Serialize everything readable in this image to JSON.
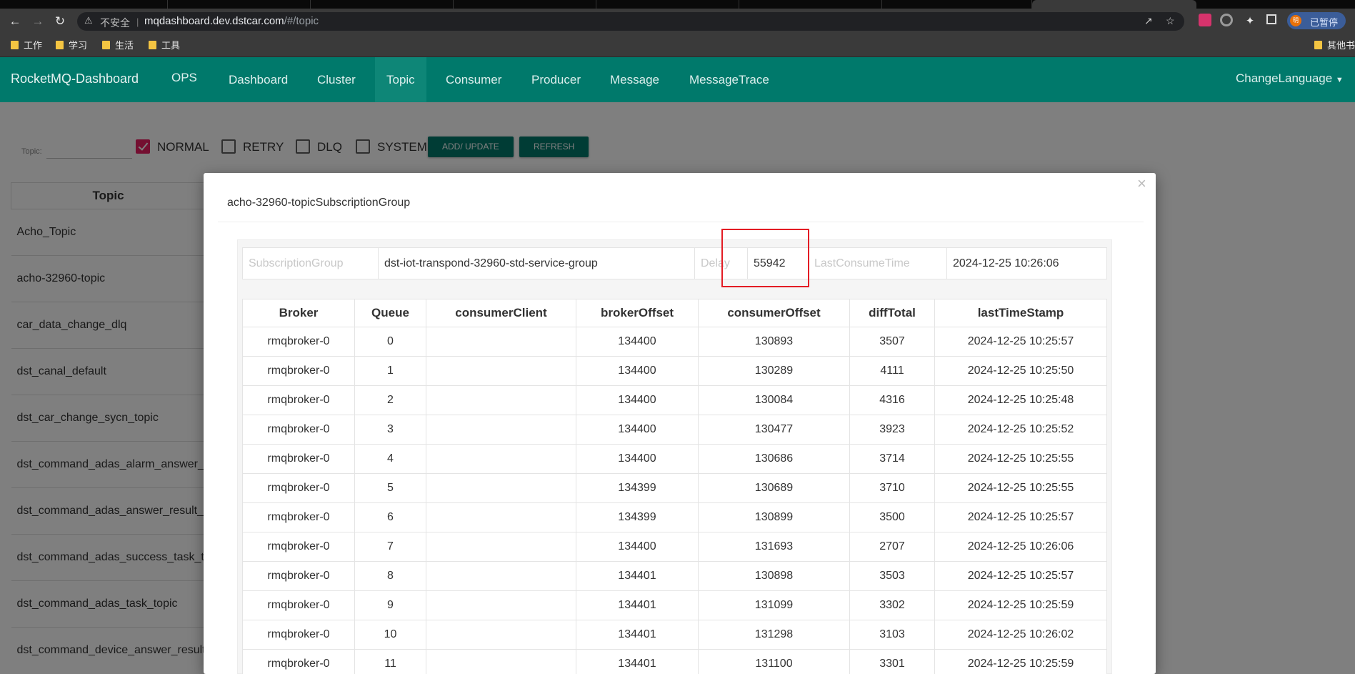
{
  "browser": {
    "insecure_label": "不安全",
    "url_host": "mqdashboard.dev.dstcar.com",
    "url_path": "/#/topic",
    "paused_label": "已暂停",
    "avatar_letter": "明"
  },
  "bookmarks": [
    {
      "label": "工作"
    },
    {
      "label": "学习"
    },
    {
      "label": "生活"
    },
    {
      "label": "工具"
    }
  ],
  "other_bookmarks": "其他书",
  "navbar": {
    "brand": "RocketMQ-Dashboard",
    "items": [
      "OPS",
      "Dashboard",
      "Cluster",
      "Topic",
      "Consumer",
      "Producer",
      "Message",
      "MessageTrace"
    ],
    "active": "Topic",
    "change_language": "ChangeLanguage"
  },
  "filters": {
    "topic_label": "Topic:",
    "normal": "NORMAL",
    "retry": "RETRY",
    "dlq": "DLQ",
    "system": "SYSTEM",
    "add_update": "ADD/ UPDATE",
    "refresh": "REFRESH"
  },
  "topics": {
    "header": "Topic",
    "rows": [
      "Acho_Topic",
      "acho-32960-topic",
      "car_data_change_dlq",
      "dst_canal_default",
      "dst_car_change_sycn_topic",
      "dst_command_adas_alarm_answer_",
      "dst_command_adas_answer_result_",
      "dst_command_adas_success_task_t",
      "dst_command_adas_task_topic",
      "dst_command_device_answer_result"
    ]
  },
  "modal": {
    "title": "acho-32960-topicSubscriptionGroup",
    "close": "×",
    "subscription": {
      "group_label": "SubscriptionGroup",
      "group_value": "dst-iot-transpond-32960-std-service-group",
      "delay_label": "Delay",
      "delay_value": "55942",
      "last_label": "LastConsumeTime",
      "last_value": "2024-12-25 10:26:06"
    },
    "queue_table": {
      "headers": [
        "Broker",
        "Queue",
        "consumerClient",
        "brokerOffset",
        "consumerOffset",
        "diffTotal",
        "lastTimeStamp"
      ],
      "rows": [
        [
          "rmqbroker-0",
          "0",
          "",
          "134400",
          "130893",
          "3507",
          "2024-12-25 10:25:57"
        ],
        [
          "rmqbroker-0",
          "1",
          "",
          "134400",
          "130289",
          "4111",
          "2024-12-25 10:25:50"
        ],
        [
          "rmqbroker-0",
          "2",
          "",
          "134400",
          "130084",
          "4316",
          "2024-12-25 10:25:48"
        ],
        [
          "rmqbroker-0",
          "3",
          "",
          "134400",
          "130477",
          "3923",
          "2024-12-25 10:25:52"
        ],
        [
          "rmqbroker-0",
          "4",
          "",
          "134400",
          "130686",
          "3714",
          "2024-12-25 10:25:55"
        ],
        [
          "rmqbroker-0",
          "5",
          "",
          "134399",
          "130689",
          "3710",
          "2024-12-25 10:25:55"
        ],
        [
          "rmqbroker-0",
          "6",
          "",
          "134399",
          "130899",
          "3500",
          "2024-12-25 10:25:57"
        ],
        [
          "rmqbroker-0",
          "7",
          "",
          "134400",
          "131693",
          "2707",
          "2024-12-25 10:26:06"
        ],
        [
          "rmqbroker-0",
          "8",
          "",
          "134401",
          "130898",
          "3503",
          "2024-12-25 10:25:57"
        ],
        [
          "rmqbroker-0",
          "9",
          "",
          "134401",
          "131099",
          "3302",
          "2024-12-25 10:25:59"
        ],
        [
          "rmqbroker-0",
          "10",
          "",
          "134401",
          "131298",
          "3103",
          "2024-12-25 10:26:02"
        ],
        [
          "rmqbroker-0",
          "11",
          "",
          "134401",
          "131100",
          "3301",
          "2024-12-25 10:25:59"
        ]
      ]
    }
  },
  "colors": {
    "navbar": "#00796b",
    "accent_checkbox": "#e91e63",
    "highlight": "#e31c24"
  }
}
